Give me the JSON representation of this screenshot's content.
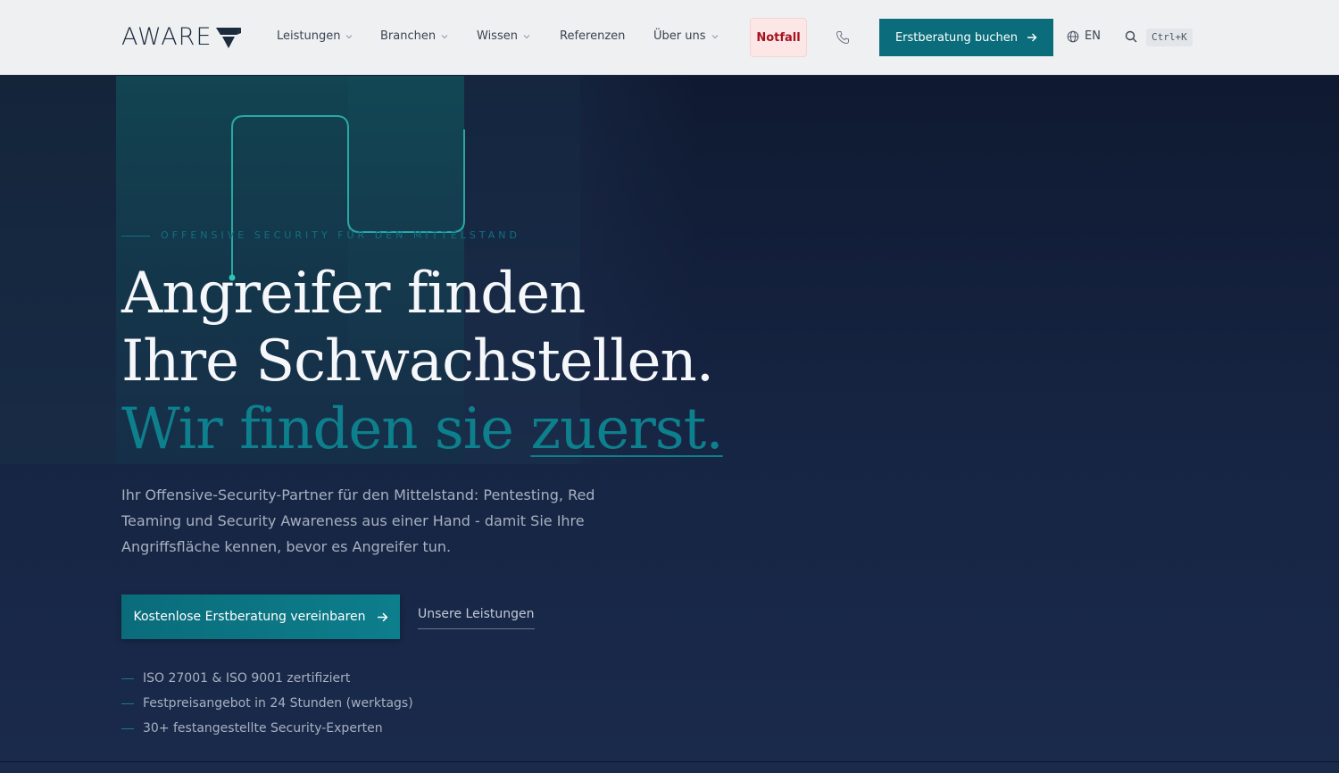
{
  "brand": {
    "name": "AWARE"
  },
  "nav": {
    "items": [
      {
        "label": "Leistungen",
        "dropdown": true
      },
      {
        "label": "Branchen",
        "dropdown": true
      },
      {
        "label": "Wissen",
        "dropdown": true
      },
      {
        "label": "Referenzen",
        "dropdown": false
      },
      {
        "label": "Über uns",
        "dropdown": true
      }
    ],
    "emergency_label": "Notfall",
    "cta_label": "Erstberatung buchen",
    "language_label": "EN",
    "search_shortcut": "Ctrl+K"
  },
  "hero": {
    "eyebrow": "OFFENSIVE SECURITY FÜR DEN MITTELSTAND",
    "headline_line1": "Angreifer finden",
    "headline_line2": "Ihre Schwachstellen.",
    "headline_accent_prefix": "Wir finden sie ",
    "headline_accent_underlined": "zuerst.",
    "lead": "Ihr Offensive-Security-Partner für den Mittelstand: Pentesting, Red Teaming und Security Awareness aus einer Hand - damit Sie Ihre Angriffsfläche kennen, bevor es Angreifer tun.",
    "primary_cta": "Kostenlose Erstberatung vereinbaren",
    "secondary_cta": "Unsere Leistungen",
    "features": [
      "ISO 27001 & ISO 9001 zertifiziert",
      "Festpreisangebot in 24 Stunden (werktags)",
      "30+ festangestellte Security-Experten"
    ]
  },
  "colors": {
    "accent": "#0b6d7c",
    "emergency_bg": "#fde6e6",
    "emergency_text": "#a3121f",
    "hero_bg": "#16213f"
  },
  "icons": [
    "chevron-down-icon",
    "phone-icon",
    "arrow-right-icon",
    "globe-icon",
    "search-icon",
    "logo-mark-icon"
  ]
}
